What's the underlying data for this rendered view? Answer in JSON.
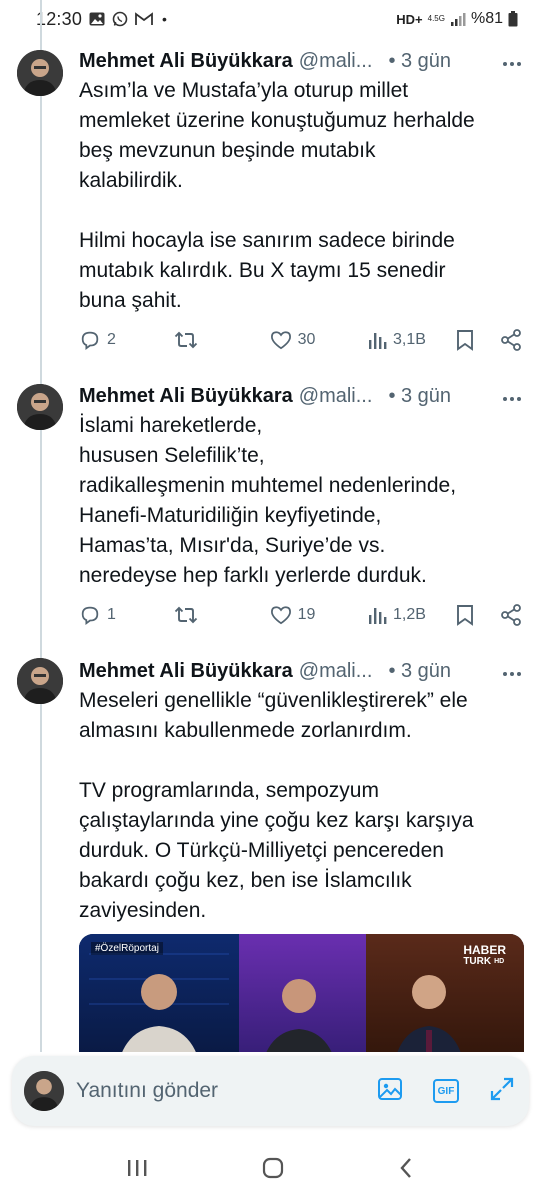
{
  "status_bar": {
    "time": "12:30",
    "network": "HD+",
    "network_sub": "4.5G",
    "battery": "%81"
  },
  "tweets": [
    {
      "author": "Mehmet Ali Büyükkara",
      "handle": "@mali...",
      "time": "• 3 gün",
      "text_lines": [
        "Asım’la ve Mustafa’yla oturup millet",
        "memleket üzerine konuştuğumuz herhalde",
        "beş mevzunun beşinde mutabık",
        "kalabilirdik."
      ],
      "text_lines_2": [
        "Hilmi hocayla ise sanırım sadece birinde",
        "mutabık kalırdık. Bu X taymı 15 senedir",
        "buna şahit."
      ],
      "replies": "2",
      "retweets": "",
      "likes": "30",
      "views": "3,1B"
    },
    {
      "author": "Mehmet Ali Büyükkara",
      "handle": "@mali...",
      "time": "• 3 gün",
      "text_lines": [
        "İslami hareketlerde,",
        "hususen Selefilik’te,",
        "radikalleşmenin muhtemel nedenlerinde,",
        "Hanefi-Maturidiliğin keyfiyetinde,",
        "Hamas’ta, Mısır'da, Suriye’de vs.",
        "neredeyse hep farklı yerlerde durduk."
      ],
      "replies": "1",
      "retweets": "",
      "likes": "19",
      "views": "1,2B"
    },
    {
      "author": "Mehmet Ali Büyükkara",
      "handle": "@mali...",
      "time": "• 3 gün",
      "text_lines": [
        "Meseleri genellikle “güvenlikleştirerek” ele",
        "almasını kabullenmede zorlanırdım."
      ],
      "text_lines_2": [
        "TV programlarında, sempozyum",
        "çalıştaylarında yine çoğu kez karşı karşıya",
        "durduk. O Türkçü-Milliyetçi pencereden",
        "bakardı çoğu kez, ben ise İslamcılık",
        "zaviyesinden."
      ],
      "media": {
        "tag": "#ÖzelRöportaj",
        "channel_top": "HABER",
        "channel_bottom": "TURK",
        "channel_hd": "HD"
      }
    }
  ],
  "reply_bar": {
    "placeholder": "Yanıtını gönder",
    "gif_label": "GIF"
  },
  "icons": {
    "accent": "#1d9bf0",
    "muted": "#536471"
  }
}
